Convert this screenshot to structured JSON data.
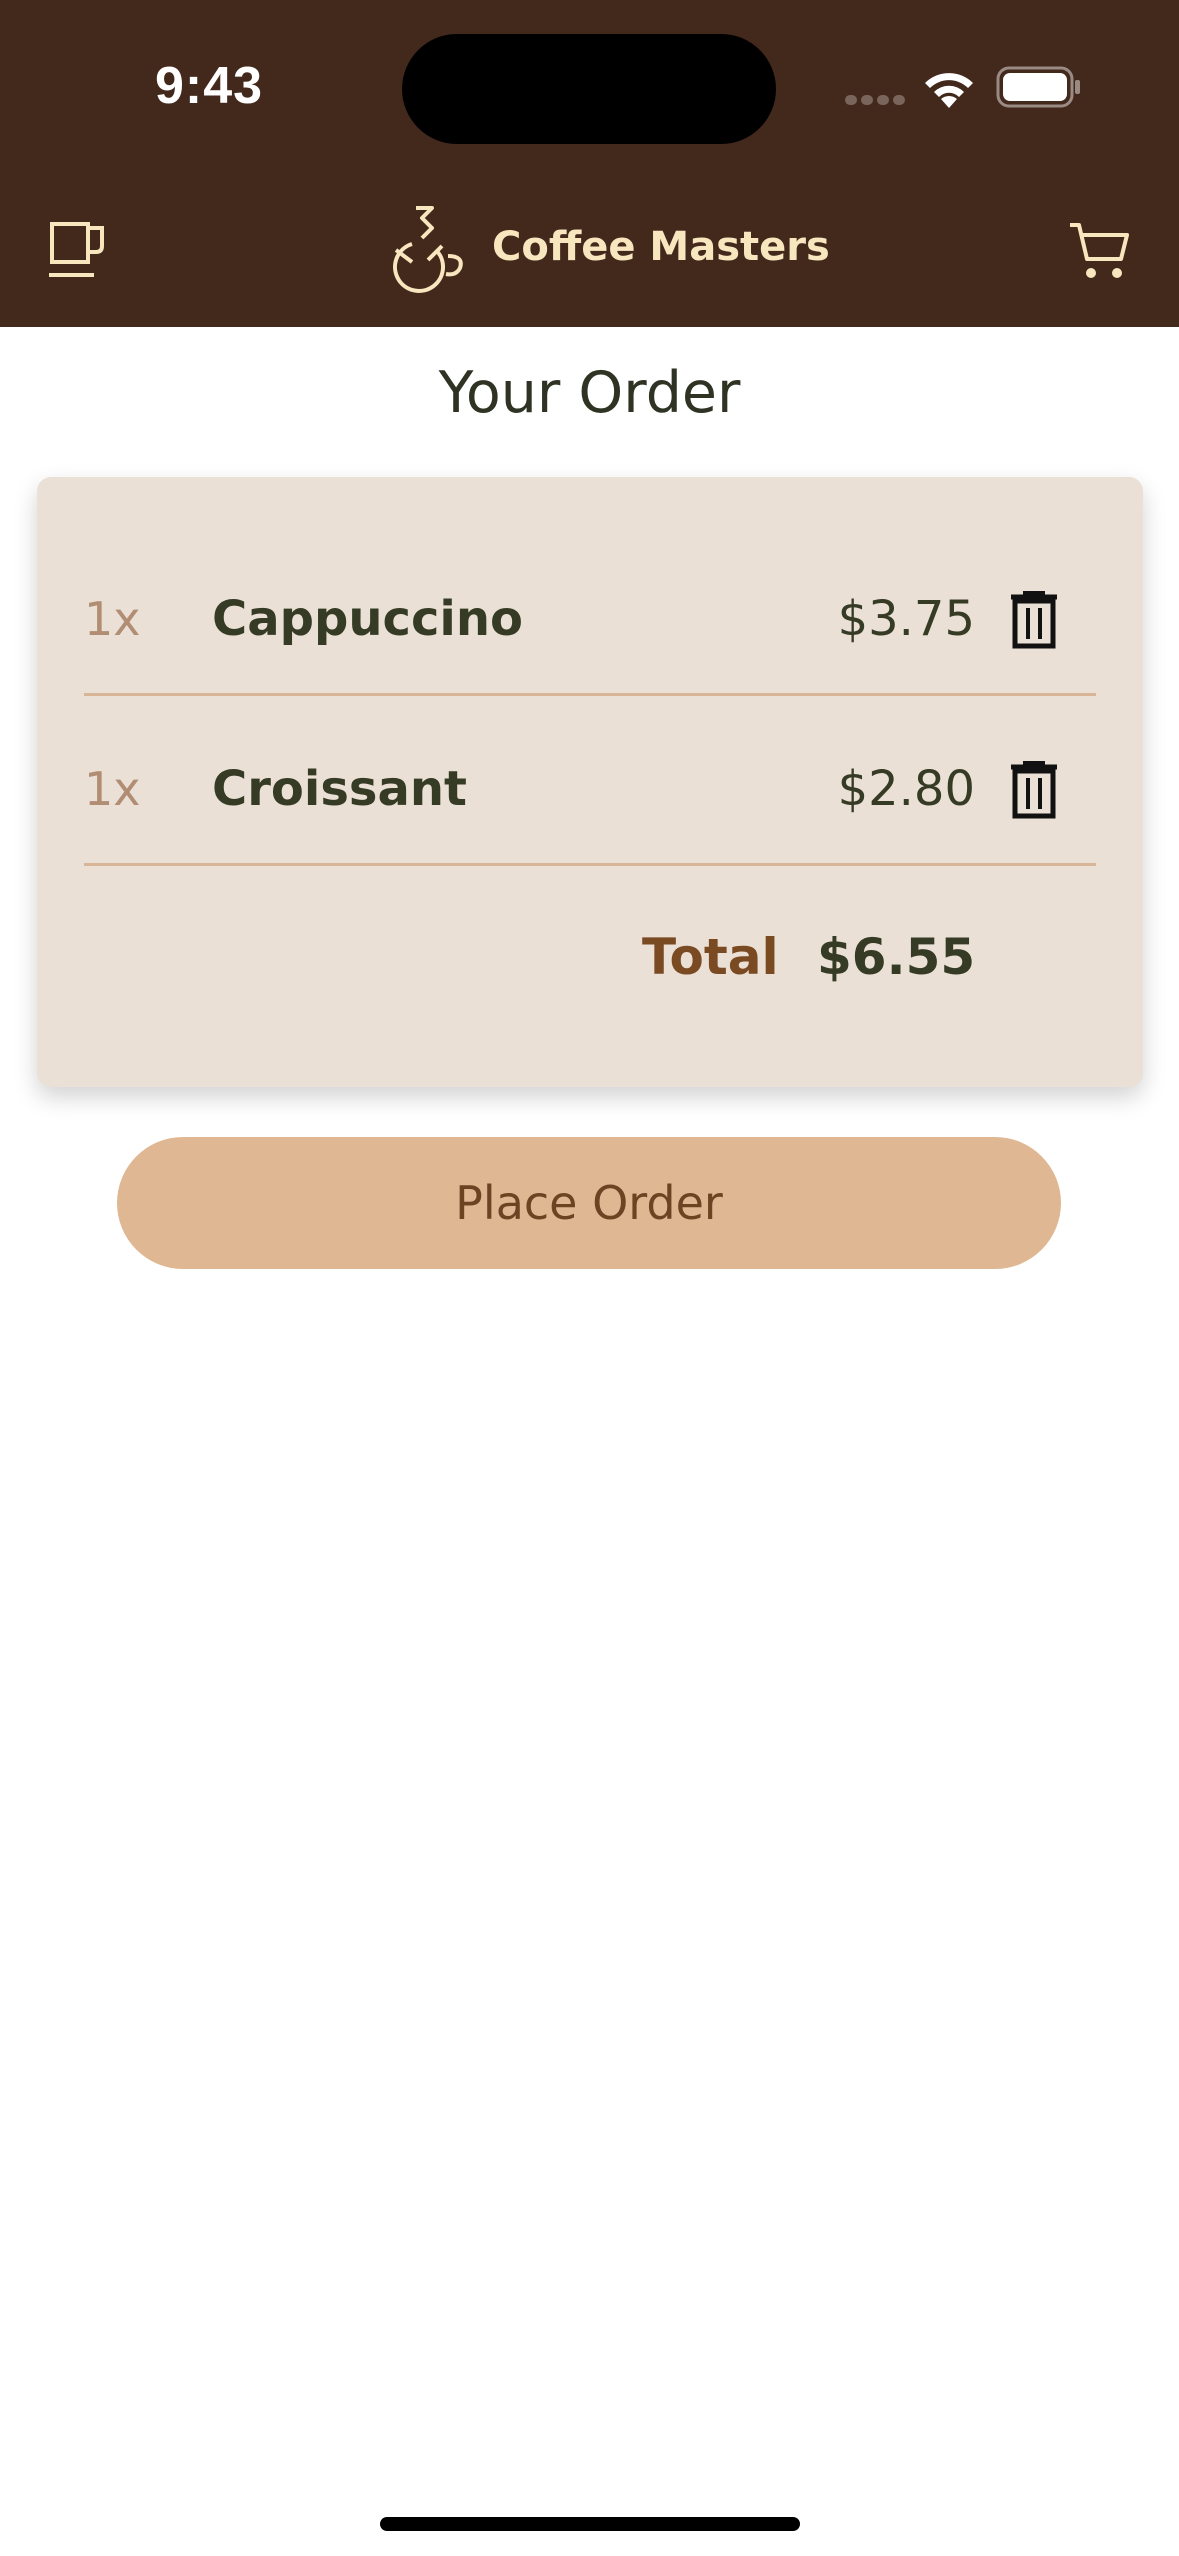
{
  "status_bar": {
    "time": "9:43"
  },
  "header": {
    "title": "Coffee Masters"
  },
  "page": {
    "title": "Your Order"
  },
  "order": {
    "items": [
      {
        "quantity": "1x",
        "name": "Cappuccino",
        "price": "$3.75"
      },
      {
        "quantity": "1x",
        "name": "Croissant",
        "price": "$2.80"
      }
    ],
    "total_label": "Total",
    "total_value": "$6.55"
  },
  "actions": {
    "place_order_label": "Place Order"
  },
  "icons": {
    "nav_left": "coffee-cup-icon",
    "brand": "coffee-pot-logo",
    "nav_right": "cart-icon",
    "delete": "trash-icon"
  },
  "colors": {
    "header_bg": "#43281c",
    "accent": "#f8e6bf",
    "card_bg": "#ebe0d5",
    "button_bg": "#dfb792"
  }
}
